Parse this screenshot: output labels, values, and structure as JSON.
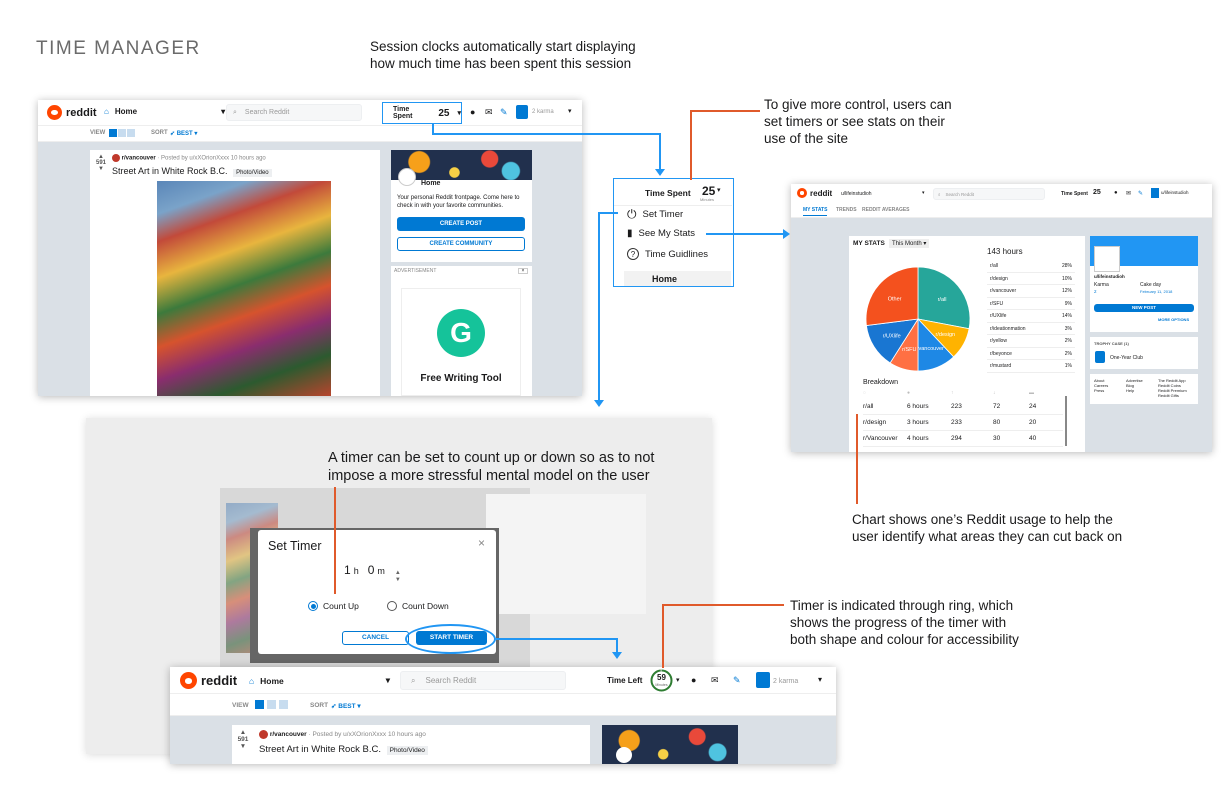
{
  "page_title": "TIME MANAGER",
  "annotations": {
    "session_clock": [
      "Session clocks automatically start displaying",
      "how much time has been spent this session"
    ],
    "control": [
      "To give more control, users can",
      "set timers or see stats on their",
      "use of the site"
    ],
    "timer_mode": [
      "A timer can be set to count up or down so as to not",
      "impose a more stressful mental model on the user"
    ],
    "chart": [
      "Chart shows one’s Reddit usage to help the",
      "user identify what areas they can cut back on"
    ],
    "ring": [
      "Timer is indicated through ring, which",
      "shows the progress of the timer with",
      "both shape and colour for accessibility"
    ]
  },
  "main_screen": {
    "logo": "reddit",
    "home": "Home",
    "search_placeholder": "Search Reddit",
    "time_spent_label": "Time Spent",
    "time_value": "25",
    "time_unit": "minutes",
    "karma": "2 karma",
    "view_label": "VIEW",
    "sort_label": "SORT",
    "sort_value": "BEST",
    "post": {
      "votes": "591",
      "subreddit": "r/vancouver",
      "posted_by": "· Posted by u/xXOrionXxxx 10 hours ago",
      "title": "Street Art in White Rock B.C.",
      "flair": "Photo/Video"
    },
    "home_card": {
      "title": "Home",
      "desc": "Your personal Reddit frontpage. Come here to check in with your favorite communities.",
      "create_post": "CREATE POST",
      "create_community": "CREATE COMMUNITY"
    },
    "ad_label": "ADVERTISEMENT",
    "ad_title": "Free Writing Tool",
    "ad_letter": "G"
  },
  "dropdown": {
    "label": "Time Spent",
    "value": "25",
    "unit": "Minutes",
    "items": [
      "Set Timer",
      "See My Stats",
      "Time Guidlines"
    ],
    "behind": "Home"
  },
  "stats_screen": {
    "logo": "reddit",
    "user": "u/lifeinstudioh",
    "search_placeholder": "Search Reddit",
    "time_spent_label": "Time Spent",
    "time_value": "25",
    "tabs": [
      "MY STATS",
      "TRENDS",
      "REDDIT AVERAGES"
    ],
    "stats_title": "MY STATS",
    "period": "This Month",
    "total": "143 hours",
    "legend": [
      {
        "name": "r/all",
        "pct": "28%"
      },
      {
        "name": "r/design",
        "pct": "10%"
      },
      {
        "name": "r/vancouver",
        "pct": "12%"
      },
      {
        "name": "r/SFU",
        "pct": "9%"
      },
      {
        "name": "r/UXlife",
        "pct": "14%"
      },
      {
        "name": "r/ideationmation",
        "pct": "3%"
      },
      {
        "name": "r/yellow",
        "pct": "2%"
      },
      {
        "name": "r/beyonce",
        "pct": "2%"
      },
      {
        "name": "r/mustard",
        "pct": "1%"
      }
    ],
    "breakdown_title": "Breakdown",
    "breakdown_rows": [
      [
        "r/all",
        "6 hours",
        "223",
        "72",
        "24"
      ],
      [
        "r/design",
        "3 hours",
        "233",
        "80",
        "20"
      ],
      [
        "r/Vancouver",
        "4 hours",
        "294",
        "30",
        "40"
      ]
    ],
    "profile": {
      "name": "u/lifeinstudioh",
      "karma_label": "Karma",
      "karma_value": "2",
      "cake_label": "Cake day",
      "cake_value": "February 11, 2018",
      "new_post": "NEW POST",
      "more": "MORE OPTIONS",
      "trophy": "TROPHY CASE (1)",
      "trophy_item": "One-Year Club"
    },
    "footer": [
      "About",
      "Careers",
      "Press",
      "Advertise",
      "Blog",
      "Help",
      "The Reddit App",
      "Reddit Coins",
      "Reddit Premium",
      "Reddit Gifts"
    ]
  },
  "chart_data": {
    "type": "pie",
    "labels": [
      "r/all",
      "r/design",
      "r/vancouver",
      "r/SFU",
      "r/UXlife",
      "Other"
    ],
    "values": [
      28,
      10,
      12,
      9,
      14,
      27
    ],
    "colors": [
      "#26a69a",
      "#ffb300",
      "#1e88e5",
      "#ff7043",
      "#1976d2",
      "#f4511e"
    ]
  },
  "timer_dialog": {
    "title": "Set Timer",
    "hours": "1",
    "hours_unit": "h",
    "minutes": "0",
    "minutes_unit": "m",
    "count_up": "Count Up",
    "count_down": "Count Down",
    "cancel": "CANCEL",
    "start": "START TIMER"
  },
  "bottom_screen": {
    "logo": "reddit",
    "home": "Home",
    "search_placeholder": "Search Reddit",
    "time_left_label": "Time Left",
    "ring_value": "59",
    "ring_unit": "Minutes",
    "ring_progress": 0.98,
    "karma": "2 karma",
    "view_label": "VIEW",
    "sort_label": "SORT",
    "sort_value": "BEST",
    "votes": "591",
    "subreddit": "r/vancouver",
    "posted_by": "· Posted by u/xXOrionXxxx 10 hours ago",
    "post_title": "Street Art in White Rock B.C.",
    "flair": "Photo/Video"
  }
}
